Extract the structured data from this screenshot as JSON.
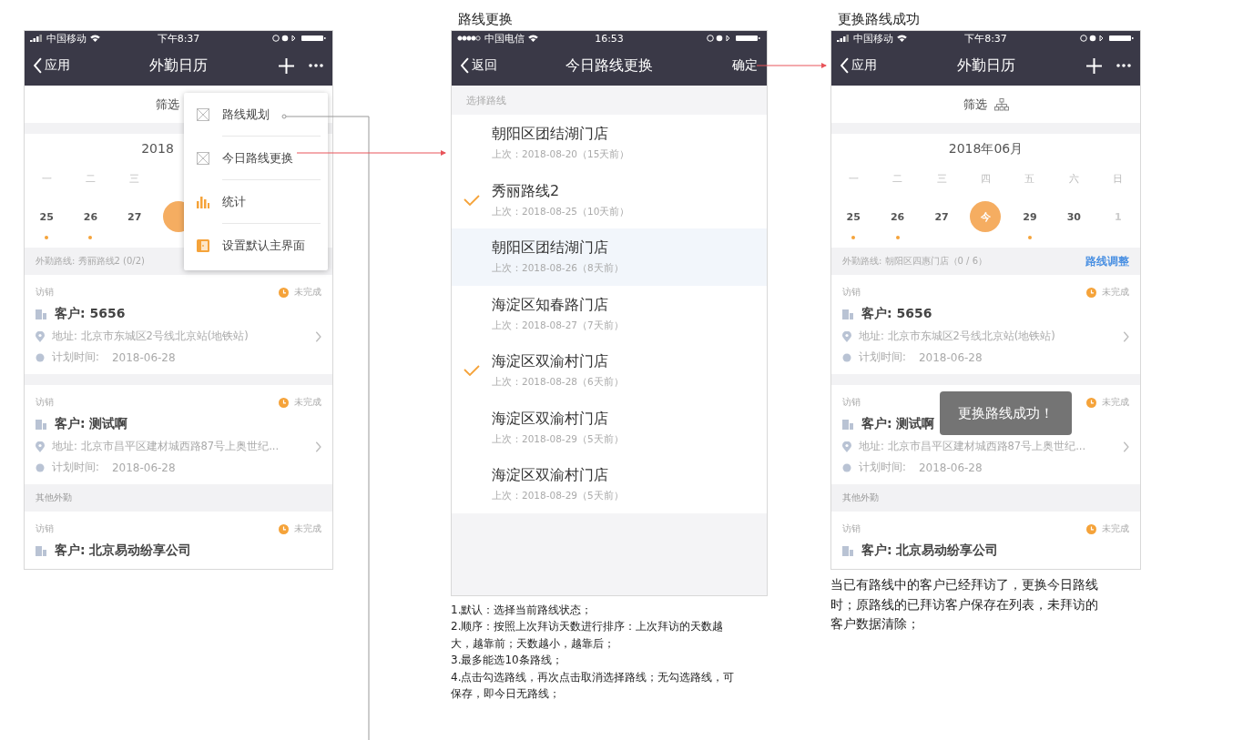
{
  "screens": [
    {
      "kind": "calendar",
      "status_bar": {
        "carrier": "中国移动",
        "time": "下午8:37"
      },
      "nav": {
        "back": "应用",
        "title": "外勤日历"
      },
      "filter": {
        "label": "筛选"
      },
      "calendar": {
        "month": "2018",
        "weekdays": [
          "一",
          "二",
          "三"
        ],
        "days": [
          {
            "label": "25",
            "dot": true,
            "today": false
          },
          {
            "label": "26",
            "dot": true,
            "today": false
          },
          {
            "label": "27",
            "dot": false,
            "today": false
          },
          {
            "dot": false,
            "today": true
          }
        ]
      },
      "route_bar": {
        "text": "外勤路线: 秀丽路线2 (0/2)"
      },
      "groups": [
        {
          "cards": [
            {
              "type": "访销",
              "status": "未完成",
              "customer": "客户: 5656",
              "address": "地址: 北京市东城区2号线北京站(地铁站)",
              "time_label": "计划时间:",
              "time": "2018-06-28"
            },
            {
              "type": "访销",
              "status": "未完成",
              "customer": "客户: 测试啊",
              "address": "地址: 北京市昌平区建材城西路87号上奥世纪...",
              "time_label": "计划时间:",
              "time": "2018-06-28"
            }
          ]
        },
        {
          "header": "其他外勤",
          "cards": [
            {
              "type": "访销",
              "status": "未完成",
              "customer": "客户: 北京易动纷享公司"
            }
          ]
        }
      ],
      "menu": [
        {
          "kind": "image",
          "label": "路线规划"
        },
        {
          "kind": "image",
          "label": "今日路线更换"
        },
        {
          "kind": "chart",
          "label": "统计"
        },
        {
          "kind": "door",
          "label": "设置默认主界面"
        }
      ]
    },
    {
      "kind": "routes",
      "title": "路线更换",
      "status_bar": {
        "carrier": "中国电信",
        "time": "16:53"
      },
      "nav": {
        "back": "返回",
        "title": "今日路线更换",
        "action": "确定"
      },
      "section": "选择路线",
      "routes": [
        {
          "name": "朝阳区团结湖门店",
          "last": "上次：2018-08-20（15天前）",
          "selected": false,
          "highlighted": false
        },
        {
          "name": "秀丽路线2",
          "last": "上次：2018-08-25（10天前）",
          "selected": true,
          "highlighted": false
        },
        {
          "name": "朝阳区团结湖门店",
          "last": "上次：2018-08-26（8天前）",
          "selected": false,
          "highlighted": true
        },
        {
          "name": "海淀区知春路门店",
          "last": "上次：2018-08-27（7天前）",
          "selected": false,
          "highlighted": false
        },
        {
          "name": "海淀区双渝村门店",
          "last": "上次：2018-08-28（6天前）",
          "selected": true,
          "highlighted": false
        },
        {
          "name": "海淀区双渝村门店",
          "last": "上次：2018-08-29（5天前）",
          "selected": false,
          "highlighted": false
        },
        {
          "name": "海淀区双渝村门店",
          "last": "上次：2018-08-29（5天前）",
          "selected": false,
          "highlighted": false
        }
      ],
      "notes": [
        "1.默认：选择当前路线状态；",
        "2.顺序：按照上次拜访天数进行排序：上次拜访的天数越大，越靠前；天数越小，越靠后；",
        "3.最多能选10条路线；",
        "4.点击勾选路线，再次点击取消选择路线；无勾选路线，可保存，即今日无路线；"
      ]
    },
    {
      "kind": "calendar",
      "title": "更换路线成功",
      "status_bar": {
        "carrier": "中国移动",
        "time": "下午8:37"
      },
      "nav": {
        "back": "应用",
        "title": "外勤日历"
      },
      "filter": {
        "label": "筛选"
      },
      "calendar": {
        "month": "2018年06月",
        "weekdays": [
          "一",
          "二",
          "三",
          "四",
          "五",
          "六",
          "日"
        ],
        "days": [
          {
            "label": "25",
            "dot": true,
            "today": false
          },
          {
            "label": "26",
            "dot": true,
            "today": false
          },
          {
            "label": "27",
            "dot": false,
            "today": false
          },
          {
            "label": "今",
            "dot": false,
            "today": true
          },
          {
            "label": "29",
            "dot": true,
            "today": false
          },
          {
            "label": "30",
            "dot": false,
            "today": false
          },
          {
            "label": "1",
            "dot": false,
            "today": false,
            "muted": true
          }
        ]
      },
      "route_bar": {
        "text": "外勤路线: 朝阳区四惠门店（0 / 6）",
        "link": "路线调整"
      },
      "groups": [
        {
          "cards": [
            {
              "type": "访销",
              "status": "未完成",
              "customer": "客户: 5656",
              "address": "地址: 北京市东城区2号线北京站(地铁站)",
              "time_label": "计划时间:",
              "time": "2018-06-28"
            },
            {
              "type": "访销",
              "status": "未完成",
              "customer": "客户: 测试啊",
              "address": "地址: 北京市昌平区建材城西路87号上奥世纪...",
              "time_label": "计划时间:",
              "time": "2018-06-28"
            }
          ]
        },
        {
          "header": "其他外勤",
          "cards": [
            {
              "type": "访销",
              "status": "未完成",
              "customer": "客户: 北京易动纷享公司"
            }
          ]
        }
      ],
      "toast": "更换路线成功！",
      "notes": [
        "当已有路线中的客户已经拜访了，更换今日路线时；原路线的已拜访客户保存在列表，未拜访的客户数据清除；"
      ]
    }
  ]
}
